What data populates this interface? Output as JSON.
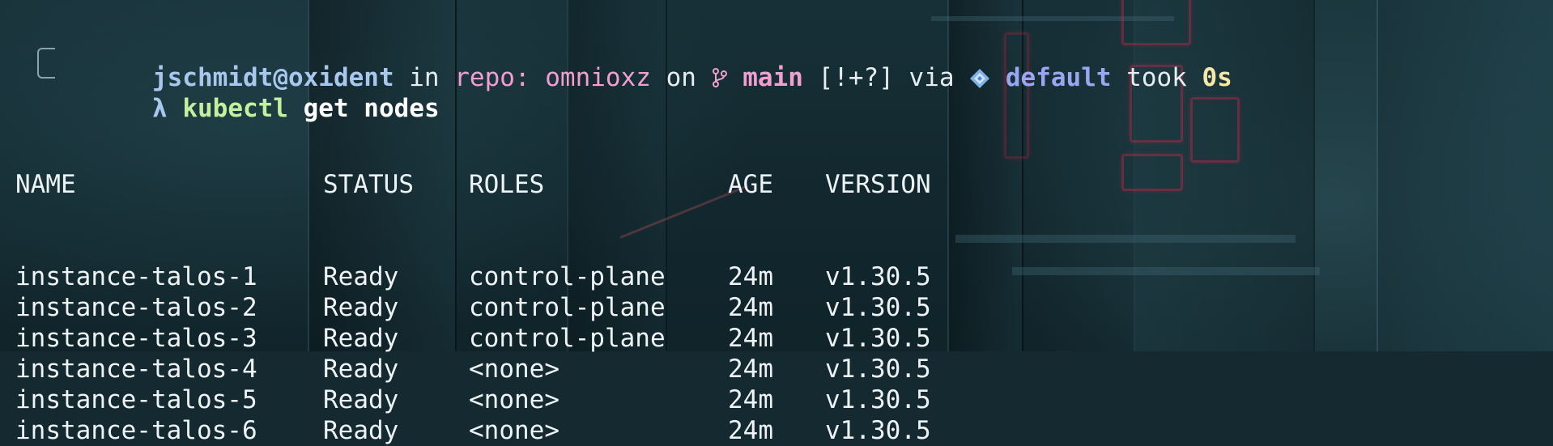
{
  "prompt": {
    "user_host": "jschmidt@oxident",
    "in_label": " in ",
    "repo_label": "repo: omnioxz",
    "on_label": " on ",
    "branch_icon": "git-branch-icon",
    "branch": "main",
    "vcs_status": " [!+?]",
    "via_label": " via ",
    "env_icon": "kubernetes-icon",
    "env": "default",
    "took_label": " took ",
    "duration": "0s",
    "lambda": "λ",
    "command": "kubectl",
    "args": " get nodes"
  },
  "table": {
    "headers": [
      "NAME",
      "STATUS",
      "ROLES",
      "AGE",
      "VERSION"
    ],
    "rows": [
      [
        "instance-talos-1",
        "Ready",
        "control-plane",
        "24m",
        "v1.30.5"
      ],
      [
        "instance-talos-2",
        "Ready",
        "control-plane",
        "24m",
        "v1.30.5"
      ],
      [
        "instance-talos-3",
        "Ready",
        "control-plane",
        "24m",
        "v1.30.5"
      ],
      [
        "instance-talos-4",
        "Ready",
        "<none>",
        "24m",
        "v1.30.5"
      ],
      [
        "instance-talos-5",
        "Ready",
        "<none>",
        "24m",
        "v1.30.5"
      ],
      [
        "instance-talos-6",
        "Ready",
        "<none>",
        "24m",
        "v1.30.5"
      ]
    ]
  },
  "colors": {
    "user": "#a7c7ee",
    "repo": "#f19ed0",
    "env": "#9aa6f2",
    "duration": "#f6e7a6",
    "command": "#c4ef9c",
    "text": "#eef3f5"
  }
}
